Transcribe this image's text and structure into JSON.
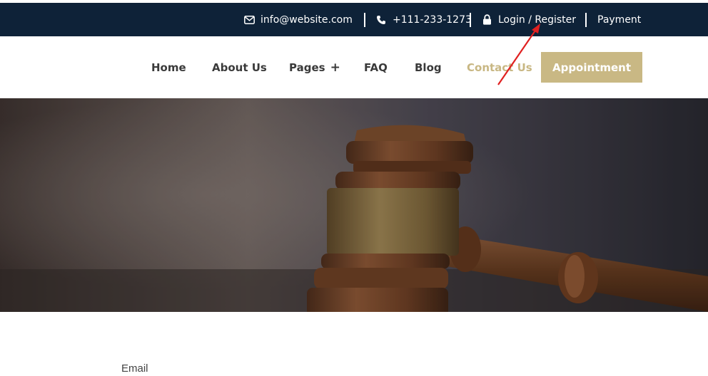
{
  "topbar": {
    "email": "info@website.com",
    "phone": "+111-233-1273",
    "login": "Login / Register",
    "payment": "Payment",
    "background": "#0e2238"
  },
  "nav": {
    "items": [
      {
        "label": "Home"
      },
      {
        "label": "About Us"
      },
      {
        "label": "Pages"
      },
      {
        "label": "FAQ"
      },
      {
        "label": "Blog"
      },
      {
        "label": "Contact Us",
        "active": true
      }
    ],
    "appointment": "Appointment",
    "accent": "#c9b884"
  },
  "hero": {
    "image": "gavel"
  },
  "form": {
    "email_label": "Email"
  },
  "annotation": {
    "arrow_color": "#e02020"
  }
}
